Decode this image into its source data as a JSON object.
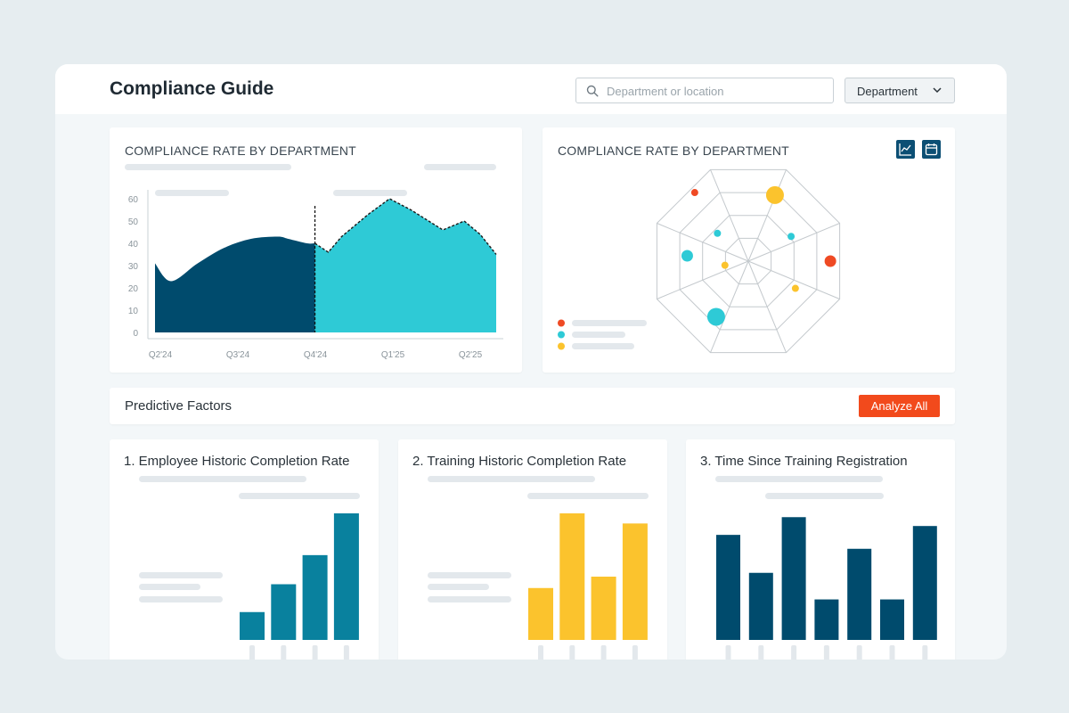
{
  "header": {
    "title": "Compliance Guide",
    "search_placeholder": "Department or location",
    "dropdown_label": "Department"
  },
  "area_card": {
    "title": "COMPLIANCE RATE BY DEPARTMENT"
  },
  "radar_card": {
    "title": "COMPLIANCE RATE BY DEPARTMENT",
    "icons": [
      "line-chart-icon",
      "calendar-icon"
    ],
    "legend_colors": [
      "#ef4a24",
      "#2ecad6",
      "#fbc32d"
    ]
  },
  "factors": {
    "title": "Predictive Factors",
    "analyze_label": "Analyze All",
    "cards": [
      {
        "title": "1. Employee Historic Completion Rate"
      },
      {
        "title": "2. Training Historic Completion Rate"
      },
      {
        "title": "3. Time Since Training Registration"
      }
    ]
  },
  "colors": {
    "navy": "#004b6d",
    "teal": "#2ecad6",
    "blue_teal": "#09819e",
    "yellow": "#fbc32d",
    "red": "#ef4a24",
    "accent_button": "#f24a1c"
  },
  "chart_data": [
    {
      "type": "area",
      "title": "COMPLIANCE RATE BY DEPARTMENT",
      "x_ticks": [
        "Q2'24",
        "Q3'24",
        "Q4'24",
        "Q1'25",
        "Q2'25"
      ],
      "y_ticks": [
        0,
        10,
        20,
        30,
        40,
        50,
        60
      ],
      "ylim": [
        0,
        60
      ],
      "series": [
        {
          "color": "#004b6d",
          "x": [
            0,
            0.3,
            0.8,
            1.3,
            1.8,
            2.3,
            2.5,
            2.85,
            3.0
          ],
          "values": [
            31,
            23,
            31,
            38,
            42,
            43,
            42,
            40,
            40
          ]
        },
        {
          "color": "#2ecad6",
          "x": [
            3.0,
            3.25,
            3.5,
            4.0,
            4.4,
            4.8,
            5.4,
            5.8,
            6.1,
            6.4
          ],
          "values": [
            40,
            36,
            43,
            53,
            60,
            55,
            46,
            50,
            44,
            35
          ]
        }
      ],
      "x_range": [
        0,
        6.4
      ],
      "divider_at": 3.0
    },
    {
      "type": "scatter",
      "subtype": "radar",
      "rings": 4,
      "axes": 8,
      "points": [
        {
          "angle": 22,
          "radius": 0.72,
          "size": 3,
          "color": "#fbc32d"
        },
        {
          "angle": -38,
          "radius": 0.88,
          "size": 1,
          "color": "#ef4a24"
        },
        {
          "angle": -48,
          "radius": 0.42,
          "size": 1,
          "color": "#2ecad6"
        },
        {
          "angle": 60,
          "radius": 0.5,
          "size": 1,
          "color": "#2ecad6"
        },
        {
          "angle": 90,
          "radius": 0.83,
          "size": 2,
          "color": "#ef4a24"
        },
        {
          "angle": -85,
          "radius": 0.62,
          "size": 2,
          "color": "#2ecad6"
        },
        {
          "angle": -100,
          "radius": 0.24,
          "size": 1,
          "color": "#fbc32d"
        },
        {
          "angle": 120,
          "radius": 0.55,
          "size": 1,
          "color": "#fbc32d"
        },
        {
          "angle": -150,
          "radius": 0.65,
          "size": 3,
          "color": "#2ecad6"
        }
      ]
    },
    {
      "type": "bar",
      "color": "#09819e",
      "values": [
        22,
        44,
        67,
        100
      ],
      "ylim": [
        0,
        100
      ]
    },
    {
      "type": "bar",
      "color": "#fbc32d",
      "values": [
        41,
        100,
        50,
        92
      ],
      "ylim": [
        0,
        100
      ]
    },
    {
      "type": "bar",
      "color": "#004b6d",
      "values": [
        83,
        53,
        97,
        32,
        72,
        32,
        90
      ],
      "ylim": [
        0,
        100
      ]
    }
  ]
}
